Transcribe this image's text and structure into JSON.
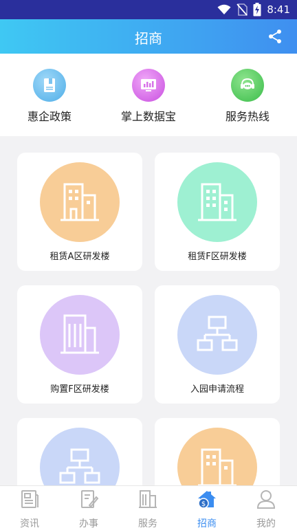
{
  "status_bar": {
    "time": "8:41"
  },
  "app_bar": {
    "title": "招商"
  },
  "quick_links": [
    {
      "label": "惠企政策",
      "icon": "policy-document-icon",
      "color": "#4faee8"
    },
    {
      "label": "掌上数据宝",
      "icon": "data-monitor-icon",
      "color": "#c94fe0"
    },
    {
      "label": "服务热线",
      "icon": "hotline-chat-icon",
      "color": "#3bbd4a"
    }
  ],
  "cards": [
    {
      "label": "租赁A区研发楼",
      "icon": "building-icon",
      "color": "#f8cd97"
    },
    {
      "label": "租赁F区研发楼",
      "icon": "building-icon",
      "color": "#9ef0d2"
    },
    {
      "label": "购置F区研发楼",
      "icon": "office-building-icon",
      "color": "#dcc6f8"
    },
    {
      "label": "入园申请流程",
      "icon": "flowchart-icon",
      "color": "#c9d7f8"
    },
    {
      "label": "",
      "icon": "flowchart-icon",
      "color": "#c9d7f8"
    },
    {
      "label": "",
      "icon": "building-icon",
      "color": "#f8cd97"
    }
  ],
  "tabs": [
    {
      "label": "资讯",
      "icon": "news-icon",
      "active": false
    },
    {
      "label": "办事",
      "icon": "task-edit-icon",
      "active": false
    },
    {
      "label": "服务",
      "icon": "service-building-icon",
      "active": false
    },
    {
      "label": "招商",
      "icon": "investment-home-icon",
      "active": true
    },
    {
      "label": "我的",
      "icon": "profile-icon",
      "active": false
    }
  ],
  "colors": {
    "accent": "#3b8df0",
    "inactive": "#9a9a9a",
    "status_bar": "#2a2f9c"
  }
}
